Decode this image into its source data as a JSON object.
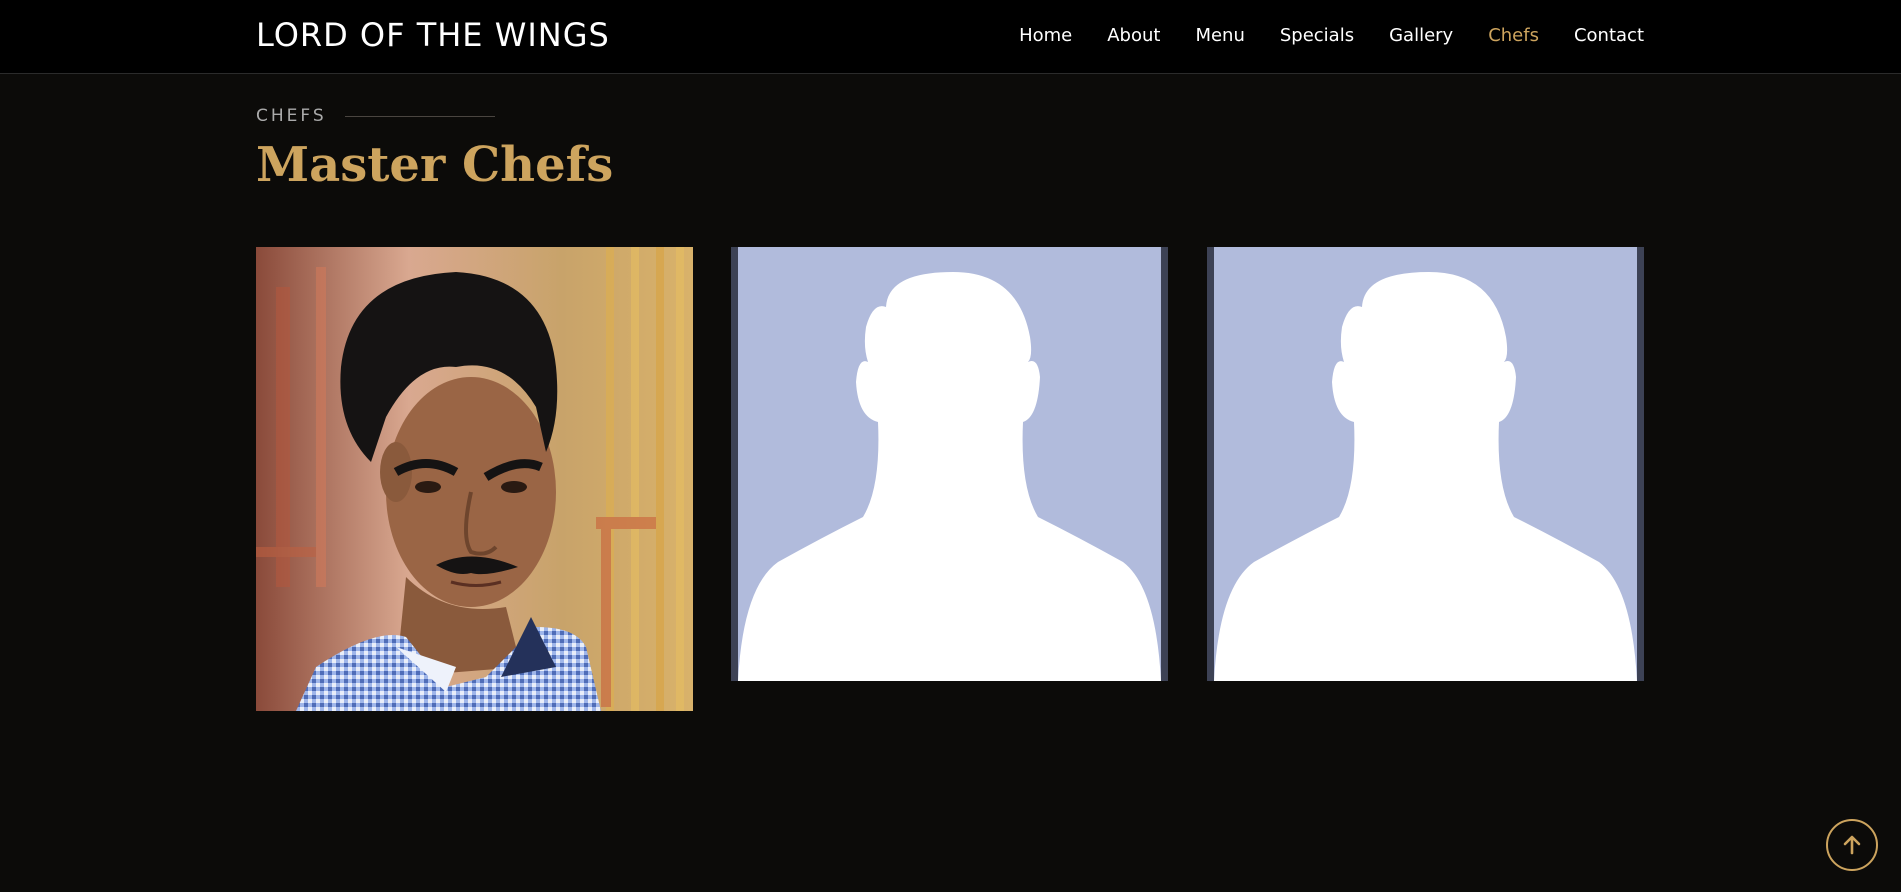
{
  "header": {
    "logo": "LORD OF THE WINGS",
    "nav": [
      {
        "label": "Home",
        "active": false
      },
      {
        "label": "About",
        "active": false
      },
      {
        "label": "Menu",
        "active": false
      },
      {
        "label": "Specials",
        "active": false
      },
      {
        "label": "Gallery",
        "active": false
      },
      {
        "label": "Chefs",
        "active": true
      },
      {
        "label": "Contact",
        "active": false
      }
    ]
  },
  "section": {
    "label": "CHEFS",
    "title": "Master Chefs"
  },
  "chefs": [
    {
      "photo": "chef-photo"
    },
    {
      "photo": "placeholder-avatar"
    },
    {
      "photo": "placeholder-avatar"
    }
  ],
  "controls": {
    "back_to_top_icon": "arrow-up-icon"
  },
  "colors": {
    "accent": "#cda45e",
    "background": "#0c0b09",
    "header": "#000000",
    "avatar_bg": "#b1bbdc"
  }
}
